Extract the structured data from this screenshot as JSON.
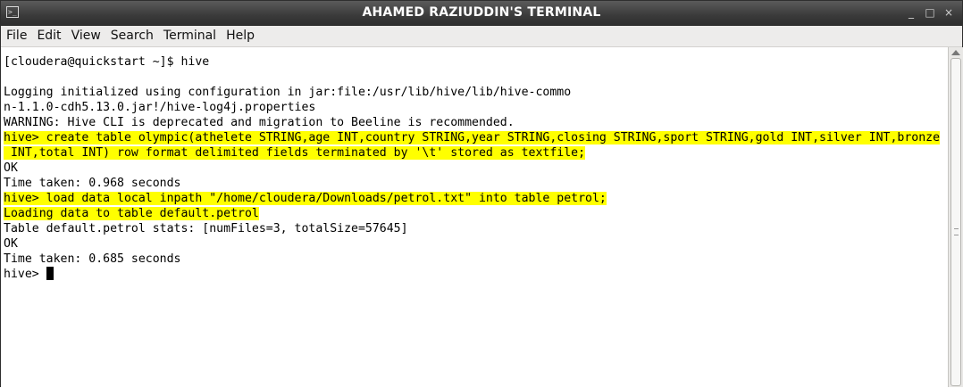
{
  "window": {
    "title": "AHAMED RAZIUDDIN'S TERMINAL",
    "controls": [
      "_",
      "□",
      "×"
    ]
  },
  "menu": [
    "File",
    "Edit",
    "View",
    "Search",
    "Terminal",
    "Help"
  ],
  "terminal": {
    "lines": [
      {
        "segments": [
          {
            "text": "[cloudera@quickstart ~]$ hive"
          }
        ]
      },
      {
        "segments": [
          {
            "text": ""
          }
        ]
      },
      {
        "segments": [
          {
            "text": "Logging initialized using configuration in jar:file:/usr/lib/hive/lib/hive-commo"
          }
        ]
      },
      {
        "segments": [
          {
            "text": "n-1.1.0-cdh5.13.0.jar!/hive-log4j.properties"
          }
        ]
      },
      {
        "segments": [
          {
            "text": "WARNING: Hive CLI is deprecated and migration to Beeline is recommended."
          }
        ]
      },
      {
        "segments": [
          {
            "text": "hive> create table olympic(athelete STRING,age INT,country STRING,year STRING,closing STRING,sport STRING,gold INT,silver INT,bronze",
            "highlight": true
          }
        ]
      },
      {
        "segments": [
          {
            "text": " INT,total INT) row format delimited fields terminated by '\\t' stored as textfile;",
            "highlight": true
          }
        ]
      },
      {
        "segments": [
          {
            "text": "OK"
          }
        ]
      },
      {
        "segments": [
          {
            "text": "Time taken: 0.968 seconds"
          }
        ]
      },
      {
        "segments": [
          {
            "text": "hive> load data local inpath \"/home/cloudera/Downloads/petrol.txt\" into table petrol;",
            "highlight": true
          }
        ]
      },
      {
        "segments": [
          {
            "text": "Loading data to table default.petrol",
            "highlight": true
          }
        ]
      },
      {
        "segments": [
          {
            "text": "Table default.petrol stats: [numFiles=3, totalSize=57645]"
          }
        ]
      },
      {
        "segments": [
          {
            "text": "OK"
          }
        ]
      },
      {
        "segments": [
          {
            "text": "Time taken: 0.685 seconds"
          }
        ]
      },
      {
        "segments": [
          {
            "text": "hive> "
          }
        ],
        "cursor": true
      }
    ]
  }
}
